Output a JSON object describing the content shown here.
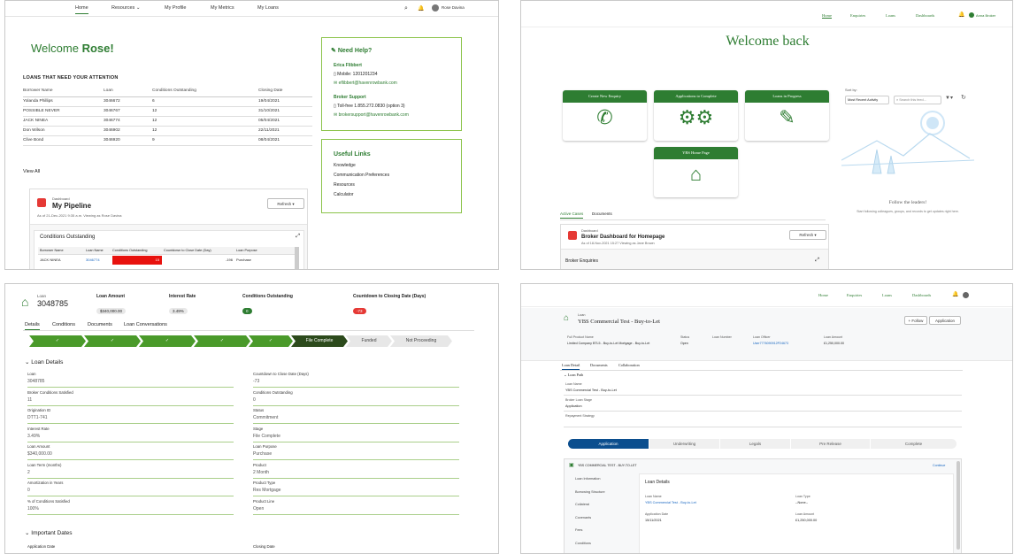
{
  "p1": {
    "nav": [
      "Home",
      "Resources",
      "My Profile",
      "My Metrics",
      "My Loans"
    ],
    "user_name": "Rose Davina",
    "welcome_prefix": "Welcome",
    "welcome_name": "Rose!",
    "section_title": "LOANS THAT NEED YOUR ATTENTION",
    "columns": [
      "Borrower Name",
      "Loan",
      "Conditions Outstanding",
      "Closing Date"
    ],
    "rows": [
      [
        "Yolanda Phillips",
        "3046672",
        "6",
        "19/04/2021"
      ],
      [
        "POSSIBLE NEVER",
        "3046767",
        "12",
        "31/10/2021"
      ],
      [
        "JACK NINEA",
        "3046774",
        "12",
        "05/04/2021"
      ],
      [
        "Don Wilson",
        "3046902",
        "12",
        "22/11/2021"
      ],
      [
        "Clive Bond",
        "3046920",
        "9",
        "08/04/2021"
      ]
    ],
    "view_all": "View All",
    "help": {
      "title": "Need Help?",
      "contact_name": "Erica Flibbert",
      "contact_mobile": "Mobile: 1201201234",
      "contact_email": "eflibbert@havenrowbank.com",
      "support_title": "Broker Support",
      "support_phone": "Toll-free 1.855.272.0830 (option 3)",
      "support_email": "brokersupport@havenrowbank.com"
    },
    "links": {
      "title": "Useful Links",
      "items": [
        "Knowledge",
        "Communication Preferences",
        "Resources",
        "Calculator"
      ]
    },
    "dashboard": {
      "label": "Dashboard",
      "title": "My Pipeline",
      "subtitle": "As of 21-Dec-2021 9:35 a.m. Viewing as Rose Davina",
      "refresh": "Refresh",
      "widget_title": "Conditions Outstanding",
      "columns": [
        "Borrower Name",
        "Loan Name",
        "Conditions Outstanding",
        "Countdown to Close Date (Day)",
        "Loan Purpose"
      ],
      "row": [
        "JACK NINEA",
        "3046774",
        "15",
        "-196",
        "Purchase"
      ]
    }
  },
  "p2": {
    "nav": [
      "Home",
      "Enquiries",
      "Loans",
      "Dashboards"
    ],
    "user": "Anna Broker",
    "welcome": "Welcome back",
    "tiles": [
      "Create New Enquiry",
      "Applications to Complete",
      "Loans in Progress",
      "YBS Home Page"
    ],
    "tabs": [
      "Active Cases",
      "Documents"
    ],
    "sort_label": "Sort by:",
    "sort_value": "Most Recent Activity",
    "search_placeholder": "Search this feed...",
    "follow_title": "Follow the leaders!",
    "follow_text": "Start following colleagues, groups, and records to get updates right here.",
    "dashboard_label": "Dashboard",
    "dashboard_title": "Broker Dashboard for Homepage",
    "dashboard_subtitle": "As of 18-Nov-2021 15:27 Viewing as Jane Brown",
    "refresh": "Refresh",
    "enquiries": "Broker Enquiries"
  },
  "p3": {
    "loan_label": "Loan",
    "loan_number": "3048785",
    "loan_amount_label": "Loan Amount",
    "loan_amount": "$340,000.00",
    "interest_label": "Interest Rate",
    "interest": "3.49%",
    "cond_label": "Conditions Outstanding",
    "cond": "0",
    "countdown_label": "Countdown to Closing Date (Days)",
    "countdown": "-73",
    "tabs": [
      "Details",
      "Conditions",
      "Documents",
      "Loan Conversations"
    ],
    "stages_current": "File Complete",
    "stages_after": [
      "Funded",
      "Not Proceeding"
    ],
    "section1": "Loan Details",
    "left_fields": [
      {
        "l": "Loan",
        "v": "3048785"
      },
      {
        "l": "Broker Conditions Satisfied",
        "v": "11"
      },
      {
        "l": "Origination ID",
        "v": "DTT1-741"
      },
      {
        "l": "Interest Rate",
        "v": "3.49%"
      },
      {
        "l": "Loan Amount",
        "v": "$340,000.00"
      },
      {
        "l": "Loan Term (months)",
        "v": "2"
      },
      {
        "l": "Amortization in Years",
        "v": "0"
      },
      {
        "l": "% of Conditions Satisfied",
        "v": "100%"
      }
    ],
    "right_fields": [
      {
        "l": "Countdown to Close Date (Days)",
        "v": "-73"
      },
      {
        "l": "Conditions Outstanding",
        "v": "0"
      },
      {
        "l": "Status",
        "v": "Commitment"
      },
      {
        "l": "Stage",
        "v": "File Complete"
      },
      {
        "l": "Loan Purpose",
        "v": "Purchase"
      },
      {
        "l": "Product",
        "v": "2 Month"
      },
      {
        "l": "Product Type",
        "v": "Res Mortgage"
      },
      {
        "l": "Product Line",
        "v": "Open"
      }
    ],
    "section2": "Important Dates",
    "date_left": "Application Date",
    "date_right": "Closing Date"
  },
  "p4": {
    "nav": [
      "Home",
      "Enquiries",
      "Loans",
      "Dashboards"
    ],
    "record_type": "Loan",
    "record_title": "YBS Commercial Test - Buy-to-Let",
    "follow": "+ Follow",
    "application": "Application",
    "header_fields": [
      {
        "l": "Full Product Name",
        "v": "Limited Company BTL5 - Buy-to-Let Mortgage - Buy-to-Let"
      },
      {
        "l": "Status",
        "v": "Open"
      },
      {
        "l": "Loan Number",
        "v": ""
      },
      {
        "l": "Loan Officer",
        "v": "User7776090912P24673"
      },
      {
        "l": "Loan Amount",
        "v": "£1,250,000.00"
      }
    ],
    "tabs": [
      "Loan Detail",
      "Documents",
      "Collaboration"
    ],
    "section": "Loan Path",
    "loan_name_label": "Loan Name",
    "loan_name": "YBS Commercial Test - Buy-to-Let",
    "stage_label": "Broker Loan Stage",
    "stage": "Application",
    "payment_label": "Repayment Strategy",
    "path": [
      "Application",
      "Underwriting",
      "Legals",
      "Pre Release",
      "Complete"
    ],
    "form_title": "YBS COMMERCIAL TEST - BUY-TO-LET",
    "continue": "Continue",
    "side_items": [
      "Loan Information",
      "Borrowing Structure",
      "Collateral",
      "Covenants",
      "Fees",
      "Conditions"
    ],
    "detail_title": "Loan Details",
    "detail_name_label": "Loan Name",
    "detail_name": "YBS Commercial Test - Buy-to-Let",
    "detail_type_label": "Loan Type",
    "detail_type": "--None--",
    "app_date_label": "Application Date",
    "app_date": "15/11/2021",
    "amount_label": "Loan Amount",
    "amount": "£1,250,000.00"
  }
}
